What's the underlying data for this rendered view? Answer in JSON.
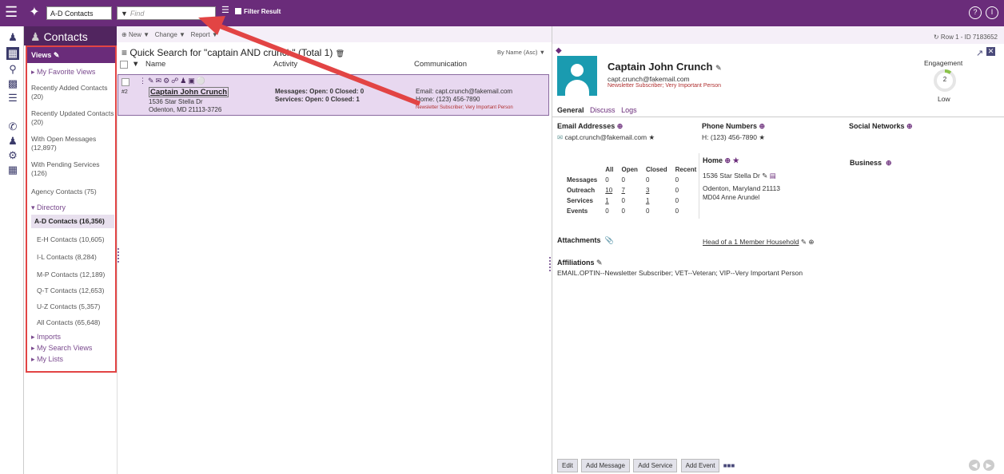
{
  "topbar": {
    "context_select": "A-D Contacts",
    "find_placeholder": "Find",
    "filter_result_label": "Filter Result"
  },
  "left_panel": {
    "title": "Contacts",
    "views_title": "Views",
    "items": [
      {
        "label": "My Favorite Views"
      },
      {
        "label": "Recently Added Contacts (20)"
      },
      {
        "label": "Recently Updated Contacts (20)"
      },
      {
        "label": "With Open Messages (12,897)"
      },
      {
        "label": "With Pending Services (126)"
      },
      {
        "label": "Agency Contacts (75)"
      }
    ],
    "directory_title": "Directory",
    "directory_items": [
      {
        "label": "A-D Contacts (16,356)"
      },
      {
        "label": "E-H Contacts (10,605)"
      },
      {
        "label": "I-L Contacts (8,284)"
      },
      {
        "label": "M-P Contacts (12,189)"
      },
      {
        "label": "Q-T Contacts (12,653)"
      },
      {
        "label": "U-Z Contacts (5,357)"
      },
      {
        "label": "All Contacts (65,648)"
      }
    ],
    "bottom_links": [
      "Imports",
      "My Search Views",
      "My Lists"
    ]
  },
  "middle": {
    "toolbar": {
      "new": "New",
      "change": "Change",
      "report": "Report"
    },
    "quick_search": "Quick Search for \"captain AND crunch\" (Total 1)",
    "sort_label": "By Name (Asc)",
    "columns": {
      "name": "Name",
      "activity": "Activity",
      "communication": "Communication"
    },
    "row": {
      "num": "#2",
      "name": "Captain John Crunch",
      "address1": "1536 Star Stella Dr",
      "address2": "Odenton, MD 21113-3726",
      "messages": "Messages: Open: 0 Closed: 0",
      "services": "Services:  Open: 0 Closed: 1",
      "email": "Email: capt.crunch@fakemail.com",
      "home": "Home: (123) 456-7890",
      "tags": "Newsletter Subscriber; Very Important Person"
    }
  },
  "right": {
    "row_id": "Row 1 - ID 7183652",
    "name": "Captain John Crunch",
    "email": "capt.crunch@fakemail.com",
    "tags": "Newsletter Subscriber; Very Important Person",
    "engagement_label": "Engagement",
    "engagement_value": "2",
    "engagement_level": "Low",
    "engagement_fraction": 0.1,
    "tabs": [
      "General",
      "Discuss",
      "Logs"
    ],
    "email_addresses_title": "Email Addresses",
    "email_address": "capt.crunch@fakemail.com",
    "phone_numbers_title": "Phone Numbers",
    "phone": "H: (123) 456-7890",
    "social_title": "Social Networks",
    "stats": {
      "headers": [
        "All",
        "Open",
        "Closed",
        "Recent"
      ],
      "rows": [
        {
          "label": "Messages",
          "values": [
            "0",
            "0",
            "0",
            "0"
          ]
        },
        {
          "label": "Outreach",
          "values": [
            "10",
            "7",
            "3",
            "0"
          ]
        },
        {
          "label": "Services",
          "values": [
            "1",
            "0",
            "1",
            "0"
          ]
        },
        {
          "label": "Events",
          "values": [
            "0",
            "0",
            "0",
            "0"
          ]
        }
      ]
    },
    "home_title": "Home",
    "home_address": [
      "1536 Star Stella Dr",
      "Odenton, Maryland 21113",
      "MD04 Anne Arundel"
    ],
    "business_title": "Business",
    "attachments_title": "Attachments",
    "household": "Head of a 1 Member Household",
    "affiliations_title": "Affiliations",
    "affiliations": "EMAIL.OPTIN--Newsletter Subscriber; VET--Veteran; VIP--Very Important Person",
    "buttons": [
      "Edit",
      "Add Message",
      "Add Service",
      "Add Event"
    ]
  },
  "colors": {
    "brand": "#6a2c7a",
    "highlight": "#e24444",
    "avatar": "#1a9bb0"
  }
}
